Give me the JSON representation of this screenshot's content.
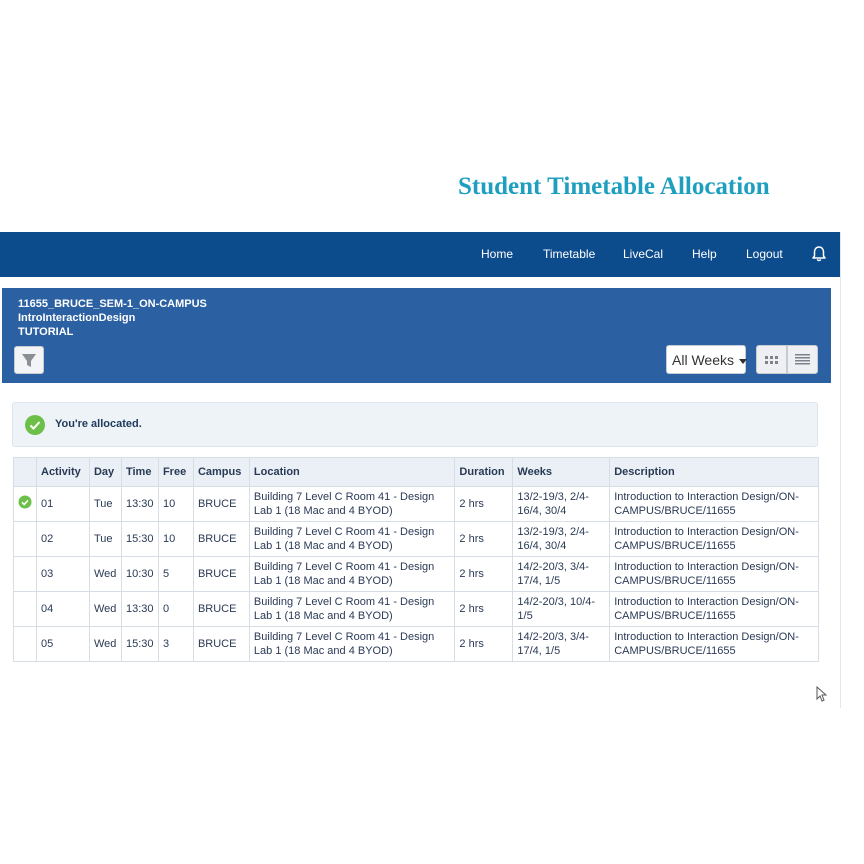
{
  "page": {
    "title": "Student Timetable Allocation"
  },
  "nav": {
    "items": [
      "Home",
      "Timetable",
      "LiveCal",
      "Help",
      "Logout"
    ],
    "bell_icon": "bell-icon"
  },
  "header": {
    "line1": "11655_BRUCE_SEM-1_ON-CAMPUS",
    "line2": "IntroInteractionDesign",
    "line3": "TUTORIAL",
    "filter_icon": "funnel-icon",
    "weeks_select": "All Weeks",
    "view_icons": [
      "grid-view-icon",
      "list-view-icon"
    ]
  },
  "alert": {
    "text": "You're allocated.",
    "icon": "check-circle-icon"
  },
  "table": {
    "columns": [
      "Activity",
      "Day",
      "Time",
      "Free",
      "Campus",
      "Location",
      "Duration",
      "Weeks",
      "Description"
    ],
    "rows": [
      {
        "allocated": true,
        "activity": "01",
        "day": "Tue",
        "time": "13:30",
        "free": "10",
        "campus": "BRUCE",
        "location": "Building 7 Level C Room 41 - Design Lab 1 (18 Mac and 4 BYOD)",
        "duration": "2 hrs",
        "weeks": "13/2-19/3, 2/4-16/4, 30/4",
        "description": "Introduction to Interaction Design/ON-CAMPUS/BRUCE/11655"
      },
      {
        "allocated": false,
        "activity": "02",
        "day": "Tue",
        "time": "15:30",
        "free": "10",
        "campus": "BRUCE",
        "location": "Building 7 Level C Room 41 - Design Lab 1 (18 Mac and 4 BYOD)",
        "duration": "2 hrs",
        "weeks": "13/2-19/3, 2/4-16/4, 30/4",
        "description": "Introduction to Interaction Design/ON-CAMPUS/BRUCE/11655"
      },
      {
        "allocated": false,
        "activity": "03",
        "day": "Wed",
        "time": "10:30",
        "free": "5",
        "campus": "BRUCE",
        "location": "Building 7 Level C Room 41 - Design Lab 1 (18 Mac and 4 BYOD)",
        "duration": "2 hrs",
        "weeks": "14/2-20/3, 3/4-17/4, 1/5",
        "description": "Introduction to Interaction Design/ON-CAMPUS/BRUCE/11655"
      },
      {
        "allocated": false,
        "activity": "04",
        "day": "Wed",
        "time": "13:30",
        "free": "0",
        "campus": "BRUCE",
        "location": "Building 7 Level C Room 41 - Design Lab 1 (18 Mac and 4 BYOD)",
        "duration": "2 hrs",
        "weeks": "14/2-20/3, 10/4-1/5",
        "description": "Introduction to Interaction Design/ON-CAMPUS/BRUCE/11655"
      },
      {
        "allocated": false,
        "activity": "05",
        "day": "Wed",
        "time": "15:30",
        "free": "3",
        "campus": "BRUCE",
        "location": "Building 7 Level C Room 41 - Design Lab 1 (18 Mac and 4 BYOD)",
        "duration": "2 hrs",
        "weeks": "14/2-20/3, 3/4-17/4, 1/5",
        "description": "Introduction to Interaction Design/ON-CAMPUS/BRUCE/11655"
      }
    ]
  },
  "colors": {
    "title": "#1e9fbf",
    "navbar": "#0c4b8c",
    "header_panel": "#2b61a3",
    "check": "#6cc04a"
  }
}
